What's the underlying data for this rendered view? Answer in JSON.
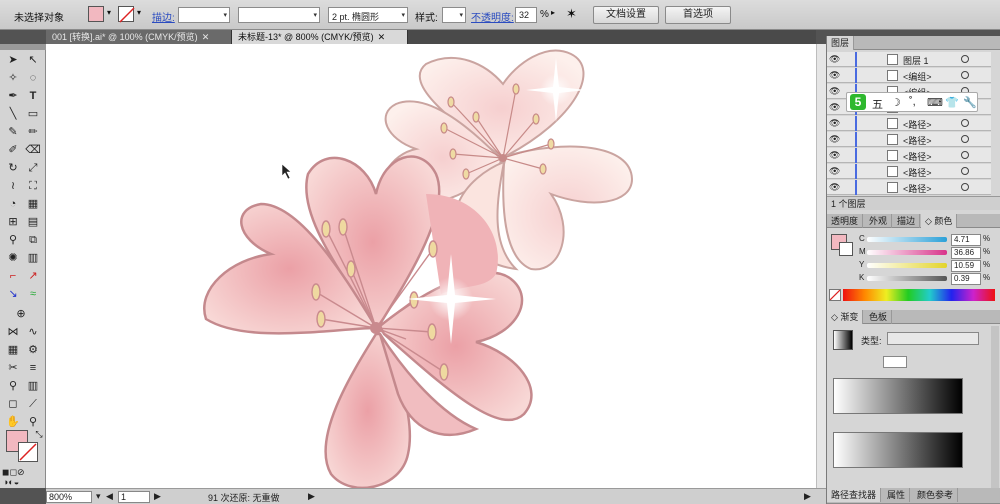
{
  "control_bar": {
    "selection_status": "未选择对象",
    "stroke_label": "描边:",
    "stroke_weight": "",
    "brush_value": "2 pt. 椭圆形",
    "style_label": "样式:",
    "opacity_label": "不透明度:",
    "opacity_value": "32",
    "opacity_unit": "%",
    "doc_setup_button": "文档设置",
    "prefs_button": "首选项"
  },
  "tabs": [
    {
      "label": "001 [转换].ai* @ 100% (CMYK/预览)",
      "close": "✕"
    },
    {
      "label": "未标题-13* @ 800% (CMYK/预览)",
      "close": "✕"
    }
  ],
  "status_bar": {
    "zoom": "800%",
    "page": "1",
    "undo_text": "91 次还原: 无重做"
  },
  "layers_panel": {
    "title": "图层",
    "rows": [
      {
        "name": "图层 1"
      },
      {
        "name": "<编组>"
      },
      {
        "name": "<编组>"
      },
      {
        "name": ""
      },
      {
        "name": "<路径>"
      },
      {
        "name": "<路径>"
      },
      {
        "name": "<路径>"
      },
      {
        "name": "<路径>"
      },
      {
        "name": "<路径>"
      }
    ],
    "count_label": "1 个图层"
  },
  "ime_bar": {
    "logo": "5",
    "mode": "五"
  },
  "color_panel": {
    "tabs": [
      "透明度",
      "外观",
      "描边",
      "颜色"
    ],
    "active_tab": "颜色",
    "channels": [
      {
        "label": "C",
        "value": "4.71",
        "color": "#2aa0d8"
      },
      {
        "label": "M",
        "value": "36.86",
        "color": "#d8338a"
      },
      {
        "label": "Y",
        "value": "10.59",
        "color": "#e3d42a"
      },
      {
        "label": "K",
        "value": "0.39",
        "color": "#555555"
      }
    ],
    "pct": "%",
    "fill_color": "#f2b8c0"
  },
  "gradient_panel": {
    "tabs": [
      "渐变",
      "色板"
    ],
    "active_tab": "渐变",
    "type_label": "类型:"
  },
  "bottom_tabs": [
    "路径查找器",
    "属性",
    "颜色参考"
  ],
  "colors": {
    "petal_light": "#f7d6d6",
    "petal_mid": "#eda6ab",
    "outline": "#c98a8e",
    "stamen": "#e8d39a",
    "back_petal": "#fbe5e0"
  }
}
